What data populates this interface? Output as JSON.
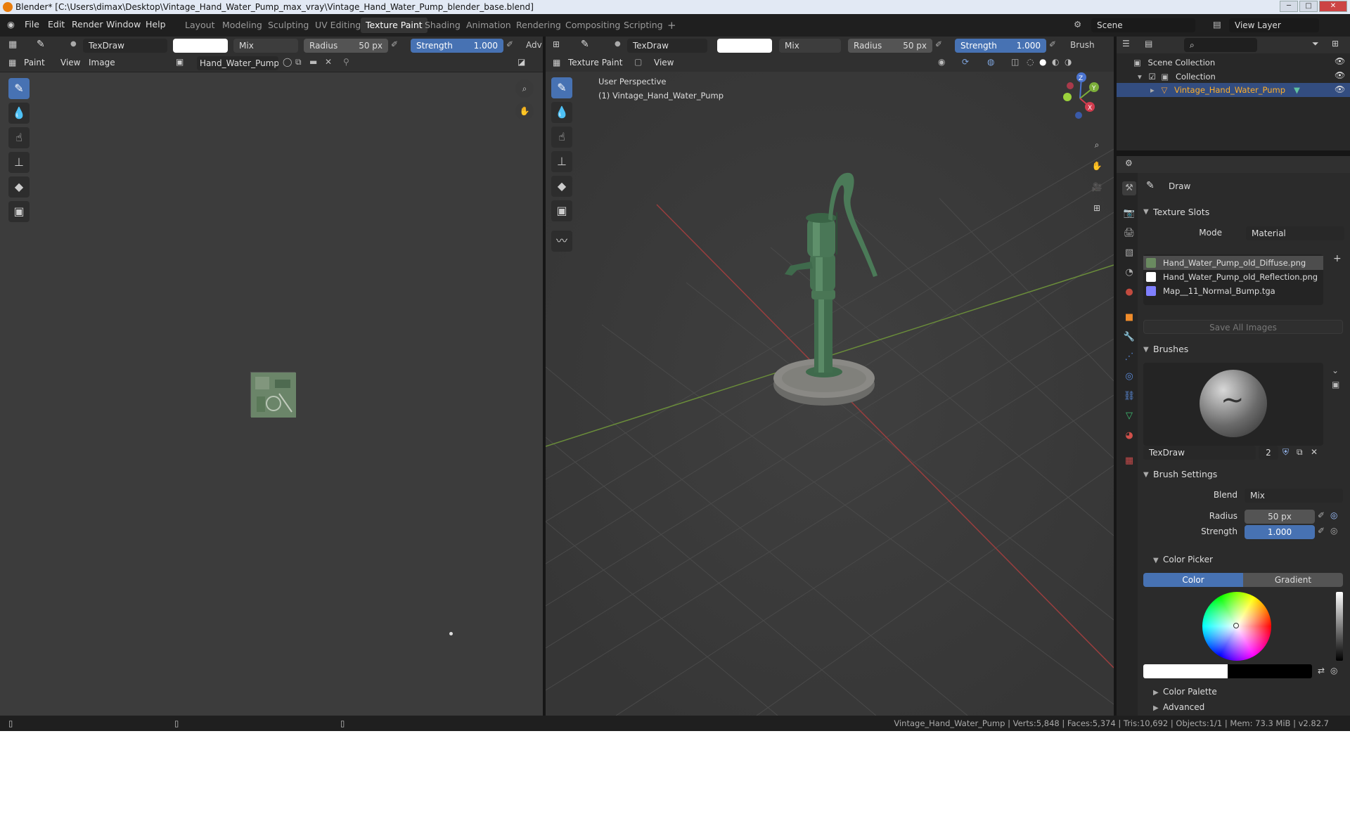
{
  "window": {
    "title": "Blender* [C:\\Users\\dimax\\Desktop\\Vintage_Hand_Water_Pump_max_vray\\Vintage_Hand_Water_Pump_blender_base.blend]",
    "min": "─",
    "max": "□",
    "close": "✕"
  },
  "menu": [
    "File",
    "Edit",
    "Render",
    "Window",
    "Help"
  ],
  "workspaces": [
    "Layout",
    "Modeling",
    "Sculpting",
    "UV Editing",
    "Texture Paint",
    "Shading",
    "Animation",
    "Rendering",
    "Compositing",
    "Scripting"
  ],
  "workspace_add": "+",
  "scene": {
    "label": "Scene",
    "view_layer": "View Layer"
  },
  "image_editor": {
    "brush": "TexDraw",
    "blend": "Mix",
    "radius_label": "Radius",
    "radius": "50 px",
    "strength_label": "Strength",
    "strength": "1.000",
    "adv": "Adv",
    "mode": "Paint",
    "view": "View",
    "image": "Image",
    "image_name": "Hand_Water_Pump_..."
  },
  "viewport": {
    "brush": "TexDraw",
    "blend": "Mix",
    "radius_label": "Radius",
    "radius": "50 px",
    "strength_label": "Strength",
    "strength": "1.000",
    "brush_menu": "Brush",
    "mode": "Texture Paint",
    "view": "View",
    "perspective": "User Perspective",
    "object": "(1) Vintage_Hand_Water_Pump",
    "axis_x": "X",
    "axis_y": "Y",
    "axis_z": "Z"
  },
  "outliner": {
    "scene_collection": "Scene Collection",
    "collection": "Collection",
    "object": "Vintage_Hand_Water_Pump"
  },
  "properties": {
    "tool": "Draw",
    "texture_slots": {
      "title": "Texture Slots",
      "mode_label": "Mode",
      "mode": "Material",
      "slots": [
        {
          "name": "Hand_Water_Pump_old_Diffuse.png",
          "color": "#6a8a60"
        },
        {
          "name": "Hand_Water_Pump_old_Reflection.png",
          "color": "#ffffff"
        },
        {
          "name": "Map__11_Normal_Bump.tga",
          "color": "#8080ff"
        }
      ],
      "save_all": "Save All Images"
    },
    "brushes": {
      "title": "Brushes",
      "name": "TexDraw",
      "users": "2"
    },
    "brush_settings": {
      "title": "Brush Settings",
      "blend_label": "Blend",
      "blend": "Mix",
      "radius_label": "Radius",
      "radius": "50 px",
      "strength_label": "Strength",
      "strength": "1.000"
    },
    "color_picker": {
      "title": "Color Picker",
      "tab_color": "Color",
      "tab_gradient": "Gradient"
    },
    "color_palette": "Color Palette",
    "advanced": "Advanced"
  },
  "status": "Vintage_Hand_Water_Pump | Verts:5,848 | Faces:5,374 | Tris:10,692 | Objects:1/1 | Mem: 73.3 MiB | v2.82.7",
  "colors": {
    "accent": "#4772b3",
    "bg": "#303030",
    "header": "#1f1f1f",
    "selected_text": "#5aa7ff"
  }
}
